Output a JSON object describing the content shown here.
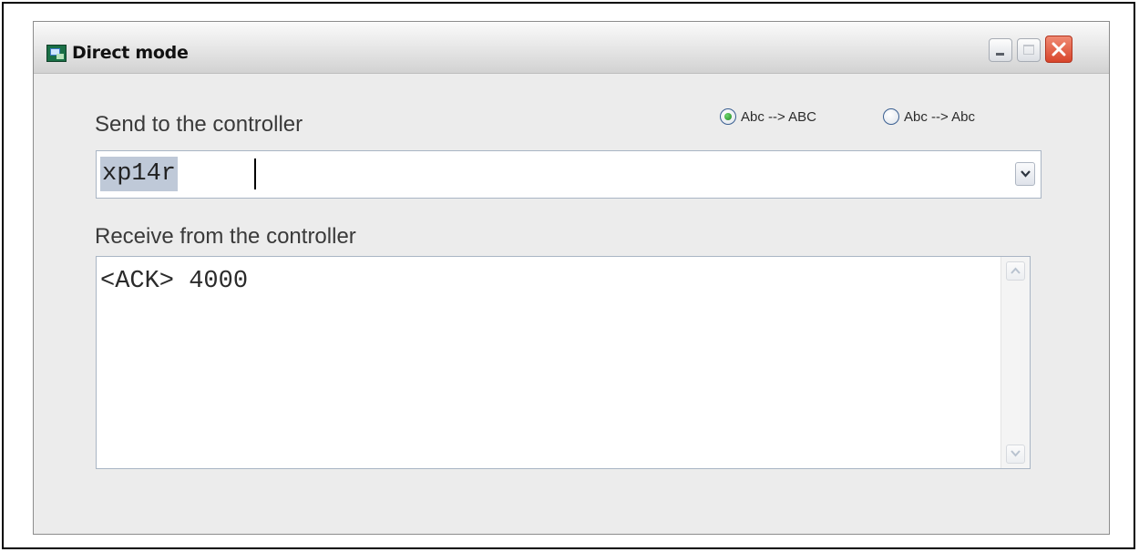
{
  "window": {
    "title": "Direct mode"
  },
  "send": {
    "label": "Send to the controller",
    "value": "xp14r"
  },
  "case_options": [
    {
      "label": "Abc --> ABC",
      "selected": true
    },
    {
      "label": "Abc --> Abc",
      "selected": false
    }
  ],
  "receive": {
    "label": "Receive from the controller",
    "content": "<ACK> 4000"
  },
  "colors": {
    "close_button": "#d8452b",
    "selection_highlight": "#bfc9d8",
    "window_background": "#ececec"
  }
}
